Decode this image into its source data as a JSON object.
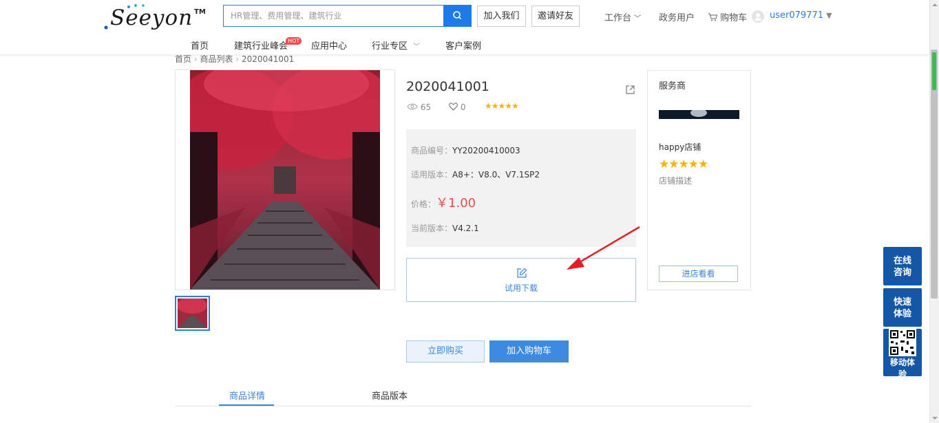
{
  "header": {
    "logo_text": "Seeyon",
    "logo_tm": "TM",
    "search_placeholder": "HR管理、费用管理、建筑行业",
    "join_us": "加入我们",
    "invite_friends": "邀请好友",
    "workbench": "工作台",
    "gov_user": "政务用户",
    "cart": "购物车",
    "username": "user079771"
  },
  "nav": {
    "items": [
      "首页",
      "建筑行业峰会",
      "应用中心",
      "行业专区",
      "客户案例"
    ],
    "hot_badge": "HOT"
  },
  "breadcrumb": [
    "首页",
    "商品列表",
    "2020041001"
  ],
  "product": {
    "title": "2020041001",
    "views": "65",
    "likes": "0",
    "rating_stars": "★★★★★",
    "code_label": "商品编号：",
    "code_value": "YY20200410003",
    "version_label": "适用版本：",
    "version_value": "A8+：V8.0、V7.1SP2",
    "price_label": "价格：",
    "price_value": "￥1.00",
    "current_label": "当前版本：",
    "current_value": "V4.2.1",
    "trial_download": "试用下载",
    "buy_now": "立即购买",
    "add_to_cart": "加入购物车"
  },
  "provider": {
    "title": "服务商",
    "name": "happy店铺",
    "stars": "★★★★★",
    "desc": "店铺描述",
    "visit": "进店看看"
  },
  "tabs": [
    "商品详情",
    "商品版本"
  ],
  "float": {
    "online": [
      "在线",
      "咨询"
    ],
    "quick": [
      "快速",
      "体验"
    ],
    "mobile": [
      "移动体",
      "验"
    ]
  },
  "colors": {
    "accent": "#1e7ce8",
    "price": "#e84c4c",
    "star": "#f5b400",
    "float_bg": "#1457a6"
  }
}
